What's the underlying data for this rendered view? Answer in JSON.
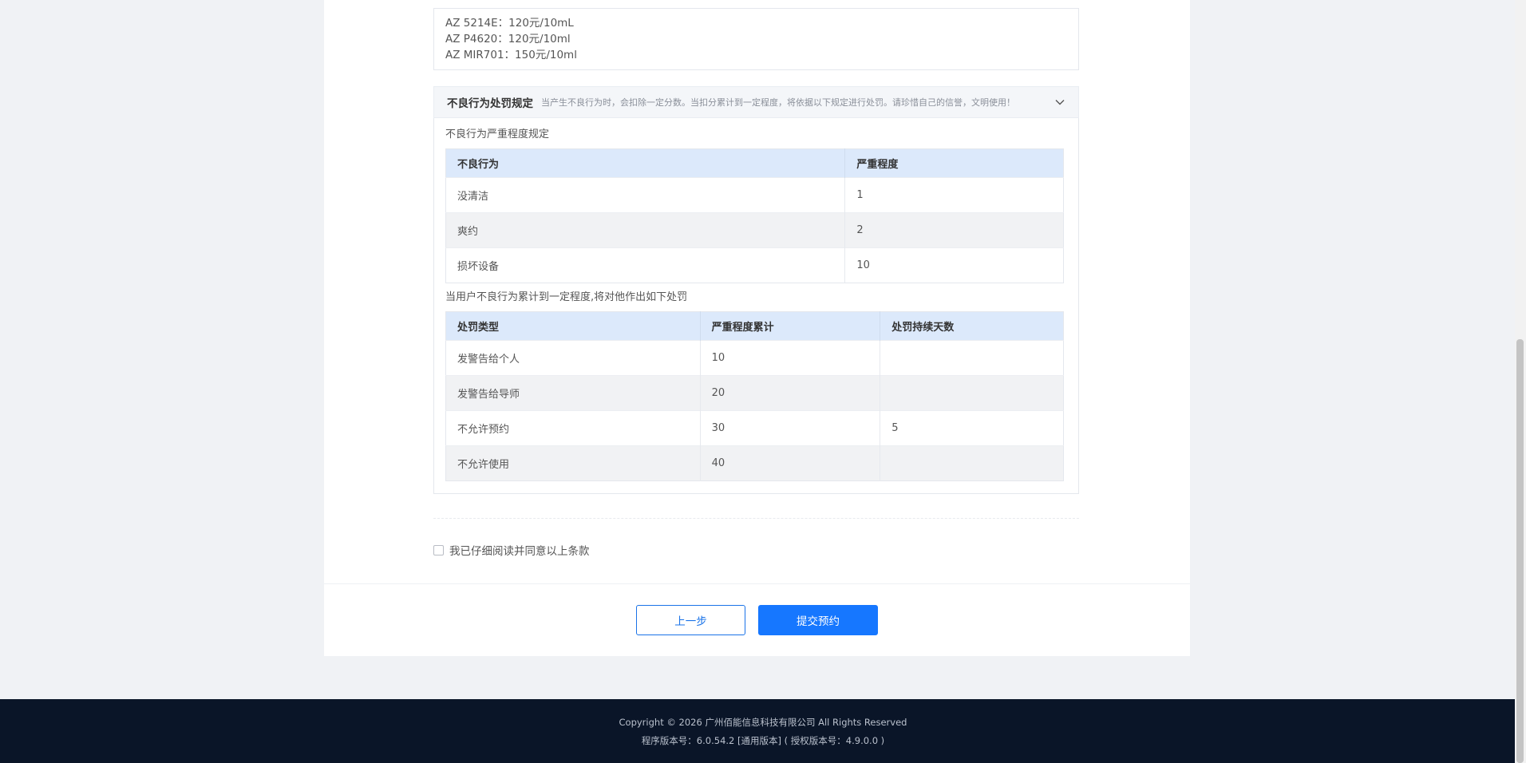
{
  "reagents": [
    "AZ 5214E：120元/10mL",
    "AZ P4620：120元/10ml",
    "AZ MIR701：150元/10ml"
  ],
  "rules": {
    "title": "不良行为处罚规定",
    "description": "当产生不良行为时，会扣除一定分数。当扣分累计到一定程度，将依据以下规定进行处罚。请珍惜自己的信誉，文明使用！",
    "severity_caption": "不良行为严重程度规定",
    "severity_table": {
      "headers": [
        "不良行为",
        "严重程度"
      ],
      "rows": [
        [
          "没清洁",
          "1"
        ],
        [
          "爽约",
          "2"
        ],
        [
          "损坏设备",
          "10"
        ]
      ]
    },
    "penalty_caption": "当用户不良行为累计到一定程度,将对他作出如下处罚",
    "penalty_table": {
      "headers": [
        "处罚类型",
        "严重程度累计",
        "处罚持续天数"
      ],
      "rows": [
        [
          "发警告给个人",
          "10",
          ""
        ],
        [
          "发警告给导师",
          "20",
          ""
        ],
        [
          "不允许预约",
          "30",
          "5"
        ],
        [
          "不允许使用",
          "40",
          ""
        ]
      ]
    }
  },
  "agreement": {
    "label": "我已仔细阅读并同意以上条款",
    "checked": false
  },
  "actions": {
    "prev_label": "上一步",
    "submit_label": "提交预约"
  },
  "footer": {
    "copyright": "Copyright © 2026 广州佰能信息科技有限公司 All Rights Reserved",
    "version": "程序版本号：6.0.54.2 [通用版本]  ( 授权版本号：4.9.0.0 )"
  },
  "colors": {
    "primary": "#1677ff",
    "table_header": "#dce9fb",
    "footer_bg": "#0a1528"
  }
}
